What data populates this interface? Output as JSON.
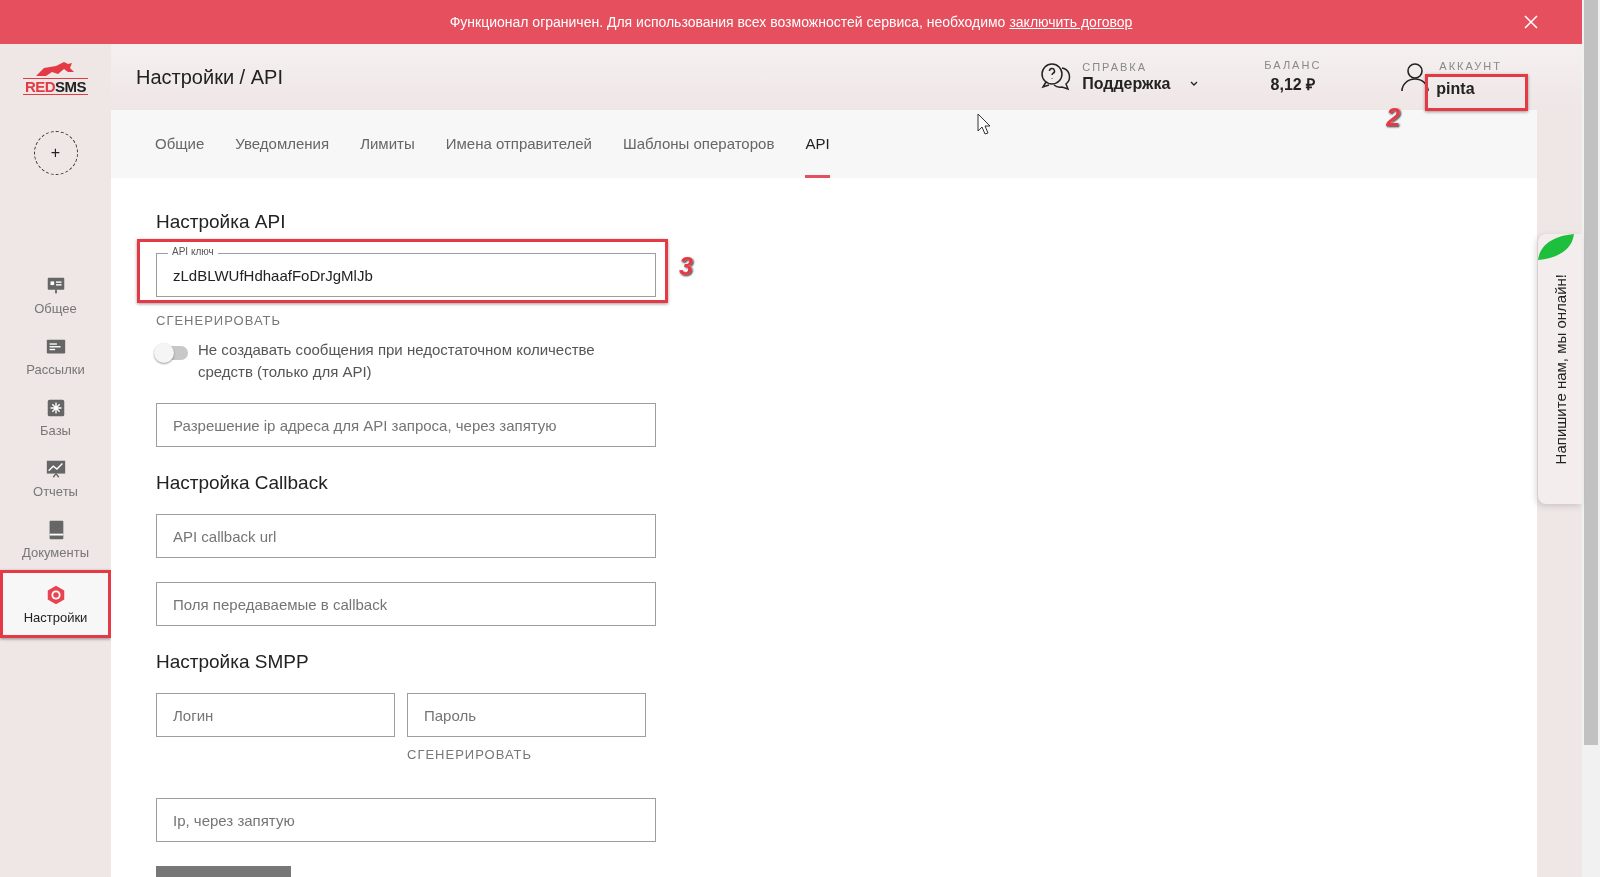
{
  "banner": {
    "text": "Функционал ограничен. Для использования всех возможностей сервиса, необходимо",
    "link": "заключить договор"
  },
  "header": {
    "logo": [
      "RED",
      "SMS"
    ],
    "title": "Настройки / API",
    "help": {
      "label": "СПРАВКА",
      "value": "Поддержка"
    },
    "balance": {
      "label": "БАЛАНС",
      "value": "8,12 ₽"
    },
    "account": {
      "label": "АККАУНТ",
      "value": "pinta",
      "highlighted": true,
      "marker": "2"
    }
  },
  "sidebar": {
    "add_button": "+",
    "items": [
      {
        "label": "Общее",
        "selected": false,
        "highlighted": false
      },
      {
        "label": "Рассылки",
        "selected": false,
        "highlighted": false
      },
      {
        "label": "Базы",
        "selected": false,
        "highlighted": false
      },
      {
        "label": "Отчеты",
        "selected": false,
        "highlighted": false
      },
      {
        "label": "Документы",
        "selected": false,
        "highlighted": false
      },
      {
        "label": "Настройки",
        "selected": true,
        "highlighted": true
      }
    ]
  },
  "tabs": [
    {
      "label": "Общие",
      "selected": false
    },
    {
      "label": "Уведомления",
      "selected": false
    },
    {
      "label": "Лимиты",
      "selected": false
    },
    {
      "label": "Имена отправителей",
      "selected": false
    },
    {
      "label": "Шаблоны операторов",
      "selected": false
    },
    {
      "label": "API",
      "selected": true
    }
  ],
  "sections": [
    {
      "title": "Настройка API",
      "items": [
        {
          "kind": "field",
          "label": "API ключ",
          "value": "zLdBLWUfHdhaafFoDrJgMlJb",
          "highlighted": true,
          "marker": "3"
        },
        {
          "kind": "action",
          "label": "СГЕНЕРИРОВАТЬ"
        },
        {
          "kind": "toggle",
          "label": "Не создавать сообщения при недостаточном количестве средств (только для API)",
          "on": false
        },
        {
          "kind": "field",
          "placeholder": "Разрешение ip адреса для API запроса, через запятую"
        }
      ]
    },
    {
      "title": "Настройка Callback",
      "items": [
        {
          "kind": "field",
          "placeholder": "API callback url"
        },
        {
          "kind": "field",
          "placeholder": "Поля передаваемые в callback"
        }
      ]
    },
    {
      "title": "Настройка SMPP",
      "items": [
        {
          "kind": "pair",
          "fields": [
            {
              "placeholder": "Логин"
            },
            {
              "placeholder": "Пароль",
              "action": "СГЕНЕРИРОВАТЬ"
            }
          ]
        },
        {
          "kind": "field",
          "placeholder": "Ip, через запятую"
        },
        {
          "kind": "button"
        }
      ]
    }
  ],
  "chat": {
    "text": "Напишите нам, мы онлайн!"
  }
}
